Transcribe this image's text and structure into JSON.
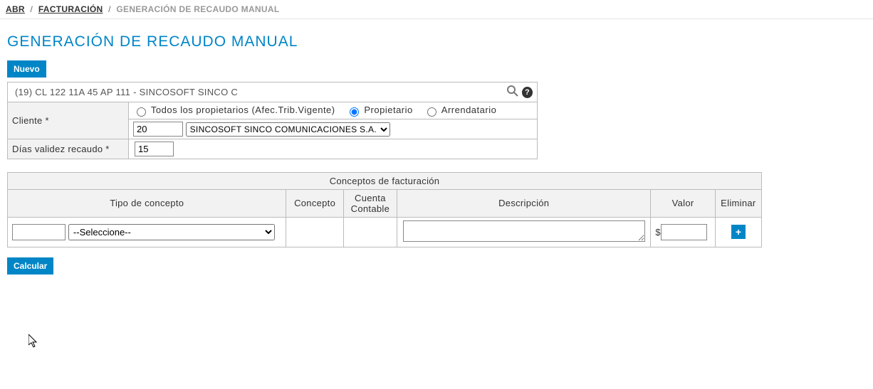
{
  "breadcrumb": {
    "level1": "ABR",
    "level2": "FACTURACIÓN",
    "current": "GENERACIÓN DE RECAUDO MANUAL"
  },
  "page_title": "GENERACIÓN DE RECAUDO MANUAL",
  "buttons": {
    "nuevo": "Nuevo",
    "calcular": "Calcular",
    "add": "+"
  },
  "search": {
    "value": "(19) CL 122 11A 45 AP 111 - SINCOSOFT SINCO C"
  },
  "labels": {
    "cliente": "Cliente *",
    "dias_validez": "Días validez recaudo *"
  },
  "cliente": {
    "radio_todos": "Todos los propietarios (Afec.Trib.Vigente)",
    "radio_propietario": "Propietario",
    "radio_arrendatario": "Arrendatario",
    "codigo": "20",
    "select_value": "SINCOSOFT SINCO COMUNICACIONES S.A."
  },
  "dias_validez_value": "15",
  "grid": {
    "group_header": "Conceptos de facturación",
    "headers": {
      "tipo": "Tipo de concepto",
      "concepto": "Concepto",
      "cuenta": "Cuenta Contable",
      "descripcion": "Descripción",
      "valor": "Valor",
      "eliminar": "Eliminar"
    },
    "row": {
      "codigo": "",
      "tipo_select": "--Seleccione--",
      "concepto": "",
      "cuenta": "",
      "descripcion": "",
      "valor_prefix": "$",
      "valor": ""
    }
  }
}
